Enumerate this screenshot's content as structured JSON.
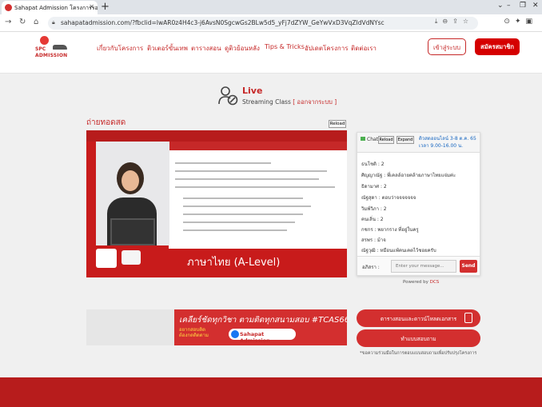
{
  "browser": {
    "tab_title": "Sahapat Admission โครงการรอบจา...",
    "url": "sahapatadmission.com/?fbclid=IwAR0z4H4c3-j6AvsN0SgcwGs2BLw5d5_yFj7dZYW_GeYwVxD3VqZIdVdNYsc"
  },
  "header": {
    "logo_text_top": "SPC",
    "logo_text_bottom": "ADMISSION",
    "menu": [
      "เกี่ยวกับโครงการ",
      "ติวเตอร์ขั้นเทพ",
      "ตารางสอน",
      "ดูติวย้อนหลัง",
      "Tips & Tricks",
      "อัปเดตโครงการ",
      "ติดต่อเรา"
    ],
    "login_label": "เข้าสู่ระบบ",
    "signup_label": "สมัครสมาชิก"
  },
  "live": {
    "title": "Live",
    "subtitle": "Streaming Class",
    "status": "[ ออกจากระบบ ]"
  },
  "stream": {
    "section_title": "ถ่ายทอดสด",
    "reload_label": "Reload",
    "subject": "ภาษาไทย (A-Level)"
  },
  "chat": {
    "label": "Chat",
    "reload_label": "Reload",
    "expand_label": "Expand",
    "schedule": "ติวสดออนไลน์ 3-8 ต.ค. 65 เวลา 9.00-16.00 น.",
    "messages": [
      "ธนโชติ : 2",
      "ศิญญาณัฐ : พี่เคลล์อายคล้ายภาษาไทยแจ่มค่ะ",
      "ธิดามาศ : 2",
      "ณัฐสุดา : ตอบว่าจจจจจจจ",
      "วิมพ์วิภา : 2",
      "คนเลิ่น : 2",
      "กชกร : พยากราง ที่อยู่ในครู",
      "สรพร : ม้าจ",
      "ณัฐวุฒิ : หมือนแพ้คนเคตไว้ชอยครับ"
    ],
    "input_label": "อภิสรา :",
    "input_placeholder": "Enter your message...",
    "send_label": "Send"
  },
  "powered": {
    "prefix": "Powered by",
    "brand": "DCS"
  },
  "banner": {
    "line1": "เคลียร์ชัดทุกวิชา ตามติดทุกสนามสอบ #TCAS66",
    "line2a": "อยากสอบติด",
    "line2b": "ต้องกดติดตาม",
    "chip": "Sahapat Admission"
  },
  "actions": {
    "schedule_btn": "ตารางสอนและดาวน์โหลดเอกสาร",
    "survey_btn": "ทำแบบสอบถาม",
    "note": "*ขอความร่วมมือในการตอบแบบสอบถามเพื่อปรับปรุงโครงการ"
  },
  "colors": {
    "brand_red": "#c62828",
    "footer": "#b71c1c"
  }
}
